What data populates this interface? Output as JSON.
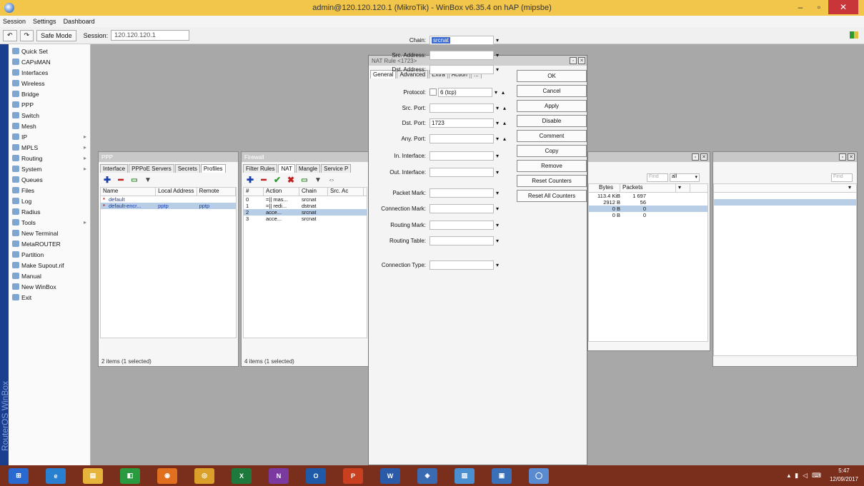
{
  "window": {
    "title": "admin@120.120.120.1 (MikroTik) - WinBox v6.35.4 on hAP (mipsbe)"
  },
  "menu": [
    "Session",
    "Settings",
    "Dashboard"
  ],
  "toolbar": {
    "safe_mode": "Safe Mode",
    "session_label": "Session:",
    "session_value": "120.120.120.1"
  },
  "sidebar_brand": "RouterOS WinBox",
  "sidebar": [
    {
      "label": "Quick Set",
      "arrow": false
    },
    {
      "label": "CAPsMAN",
      "arrow": false
    },
    {
      "label": "Interfaces",
      "arrow": false
    },
    {
      "label": "Wireless",
      "arrow": false
    },
    {
      "label": "Bridge",
      "arrow": false
    },
    {
      "label": "PPP",
      "arrow": false
    },
    {
      "label": "Switch",
      "arrow": false
    },
    {
      "label": "Mesh",
      "arrow": false
    },
    {
      "label": "IP",
      "arrow": true
    },
    {
      "label": "MPLS",
      "arrow": true
    },
    {
      "label": "Routing",
      "arrow": true
    },
    {
      "label": "System",
      "arrow": true
    },
    {
      "label": "Queues",
      "arrow": false
    },
    {
      "label": "Files",
      "arrow": false
    },
    {
      "label": "Log",
      "arrow": false
    },
    {
      "label": "Radius",
      "arrow": false
    },
    {
      "label": "Tools",
      "arrow": true
    },
    {
      "label": "New Terminal",
      "arrow": false
    },
    {
      "label": "MetaROUTER",
      "arrow": false
    },
    {
      "label": "Partition",
      "arrow": false
    },
    {
      "label": "Make Supout.rif",
      "arrow": false
    },
    {
      "label": "Manual",
      "arrow": false
    },
    {
      "label": "New WinBox",
      "arrow": false
    },
    {
      "label": "Exit",
      "arrow": false
    }
  ],
  "ppp_panel": {
    "title": "PPP",
    "tabs": [
      "Interface",
      "PPPoE Servers",
      "Secrets",
      "Profiles"
    ],
    "columns": [
      "Name",
      "Local Address",
      "Remote"
    ],
    "rows": [
      {
        "name": "default",
        "local": "",
        "remote": "",
        "selected": false
      },
      {
        "name": "default-encr...",
        "local": "pptp",
        "remote": "pptp",
        "selected": true
      }
    ],
    "footer": "2 items (1 selected)"
  },
  "firewall_panel": {
    "title": "Firewall",
    "tabs": [
      "Filter Rules",
      "NAT",
      "Mangle",
      "Service P"
    ],
    "active_tab": "NAT",
    "columns": [
      "#",
      "Action",
      "Chain",
      "Src. Ac"
    ],
    "rows": [
      {
        "num": "0",
        "action": "=|| mas...",
        "chain": "srcnat",
        "selected": false
      },
      {
        "num": "1",
        "action": "=|| redi...",
        "chain": "dstnat",
        "selected": false
      },
      {
        "num": "2",
        "action": "acce...",
        "chain": "srcnat",
        "selected": true
      },
      {
        "num": "3",
        "action": "acce...",
        "chain": "srcnat",
        "selected": false
      }
    ],
    "footer": "4 items (1 selected)"
  },
  "counters_panel": {
    "find_placeholder": "Find",
    "filter_value": "all",
    "columns": [
      "Bytes",
      "Packets"
    ],
    "rows": [
      {
        "bytes": "113.4 KiB",
        "packets": "1 697"
      },
      {
        "bytes": "2912 B",
        "packets": "56"
      },
      {
        "bytes": "0 B",
        "packets": "0"
      },
      {
        "bytes": "0 B",
        "packets": "0"
      }
    ]
  },
  "far_panel": {
    "find_placeholder": "Find"
  },
  "nat_dialog": {
    "title": "NAT Rule <1723>",
    "tabs": [
      "General",
      "Advanced",
      "Extra",
      "Action",
      "..."
    ],
    "fields": [
      {
        "label": "Chain:",
        "value": "srcnat"
      },
      {
        "label": "Src. Address:",
        "value": ""
      },
      {
        "label": "Dst. Address:",
        "value": ""
      },
      {
        "label": "Protocol:",
        "value": "6 (tcp)"
      },
      {
        "label": "Src. Port:",
        "value": ""
      },
      {
        "label": "Dst. Port:",
        "value": "1723"
      },
      {
        "label": "Any. Port:",
        "value": ""
      },
      {
        "label": "In. Interface:",
        "value": ""
      },
      {
        "label": "Out. Interface:",
        "value": ""
      },
      {
        "label": "Packet Mark:",
        "value": ""
      },
      {
        "label": "Connection Mark:",
        "value": ""
      },
      {
        "label": "Routing Mark:",
        "value": ""
      },
      {
        "label": "Routing Table:",
        "value": ""
      },
      {
        "label": "Connection Type:",
        "value": ""
      }
    ],
    "buttons": [
      "OK",
      "Cancel",
      "Apply",
      "Disable",
      "Comment",
      "Copy",
      "Remove",
      "Reset Counters",
      "Reset All Counters"
    ]
  },
  "taskbar": {
    "clock_time": "5:47",
    "clock_date": "12/09/2017"
  }
}
